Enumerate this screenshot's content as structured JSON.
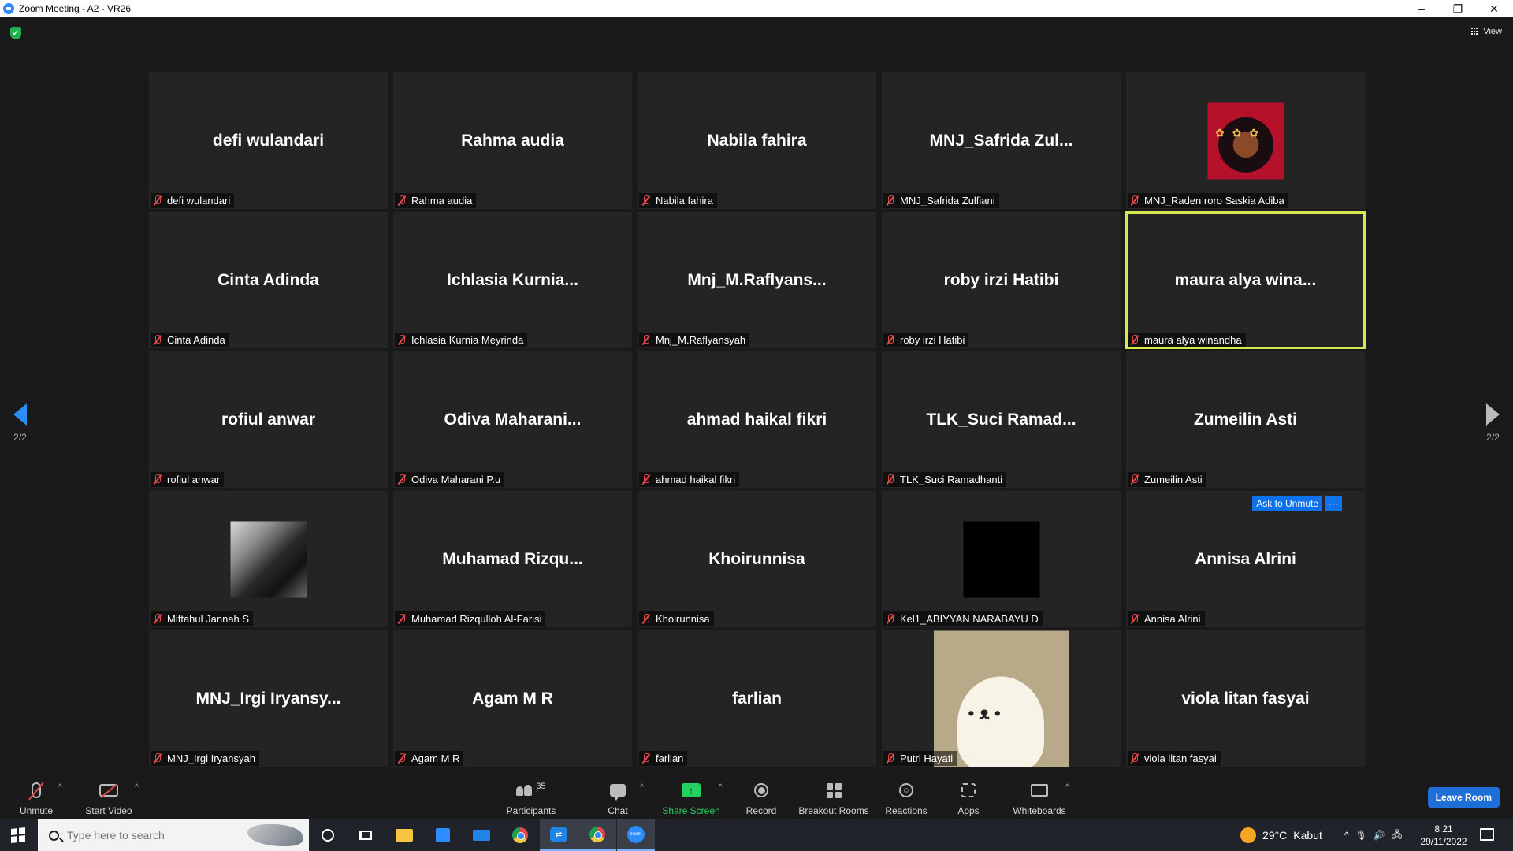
{
  "window": {
    "title": "Zoom Meeting - A2 - VR26",
    "minimize": "–",
    "maximize": "❐",
    "close": "✕"
  },
  "meeting": {
    "view_label": "View",
    "page_indicator": "2/2",
    "ask_to_unmute": "Ask to Unmute",
    "more": "···",
    "tiles": [
      {
        "display": "defi wulandari",
        "label": "defi wulandari"
      },
      {
        "display": "Rahma audia",
        "label": "Rahma audia"
      },
      {
        "display": "Nabila fahira",
        "label": "Nabila fahira"
      },
      {
        "display": "MNJ_Safrida  Zul...",
        "label": "MNJ_Safrida Zulfiani"
      },
      {
        "display": "",
        "label": "MNJ_Raden roro Saskia Adiba"
      },
      {
        "display": "Cinta Adinda",
        "label": "Cinta Adinda"
      },
      {
        "display": "Ichlasia  Kurnia...",
        "label": "Ichlasia Kurnia Meyrinda"
      },
      {
        "display": "Mnj_M.Raflyans...",
        "label": "Mnj_M.Raflyansyah"
      },
      {
        "display": "roby irzi Hatibi",
        "label": "roby irzi Hatibi"
      },
      {
        "display": "maura  alya  wina...",
        "label": "maura alya winandha"
      },
      {
        "display": "rofiul anwar",
        "label": "rofiul anwar"
      },
      {
        "display": "Odiva  Maharani...",
        "label": "Odiva Maharani P.u"
      },
      {
        "display": "ahmad haikal fikri",
        "label": "ahmad haikal fikri"
      },
      {
        "display": "TLK_Suci  Ramad...",
        "label": "TLK_Suci Ramadhanti"
      },
      {
        "display": "Zumeilin Asti",
        "label": "Zumeilin Asti"
      },
      {
        "display": "",
        "label": "Miftahul Jannah S"
      },
      {
        "display": "Muhamad  Rizqu...",
        "label": "Muhamad Rizqulloh Al-Farisi"
      },
      {
        "display": "Khoirunnisa",
        "label": "Khoirunnisa"
      },
      {
        "display": "",
        "label": "Kel1_ABIYYAN NARABAYU D"
      },
      {
        "display": "Annisa Alrini",
        "label": "Annisa Alrini"
      },
      {
        "display": "MNJ_Irgi  Iryansy...",
        "label": "MNJ_Irgi Iryansyah"
      },
      {
        "display": "Agam M R",
        "label": "Agam M R"
      },
      {
        "display": "farlian",
        "label": "farlian"
      },
      {
        "display": "",
        "label": "Putri Hayati"
      },
      {
        "display": "viola litan fasyai",
        "label": "viola litan fasyai"
      }
    ]
  },
  "toolbar": {
    "unmute": "Unmute",
    "start_video": "Start Video",
    "participants": "Participants",
    "participants_count": "35",
    "chat": "Chat",
    "share_screen": "Share Screen",
    "record": "Record",
    "breakout_rooms": "Breakout Rooms",
    "reactions": "Reactions",
    "apps": "Apps",
    "whiteboards": "Whiteboards",
    "leave_room": "Leave Room",
    "caret": "^"
  },
  "taskbar": {
    "search_placeholder": "Type here to search",
    "temperature": "29°C",
    "weather": "Kabut",
    "time": "8:21",
    "date": "29/11/2022",
    "zoom_icon_text": "zoom"
  },
  "colors": {
    "active_speaker_border": "#d8e84f",
    "share_green": "#23d160",
    "accent_blue": "#0e72ed",
    "muted_red": "#e04a4a"
  }
}
